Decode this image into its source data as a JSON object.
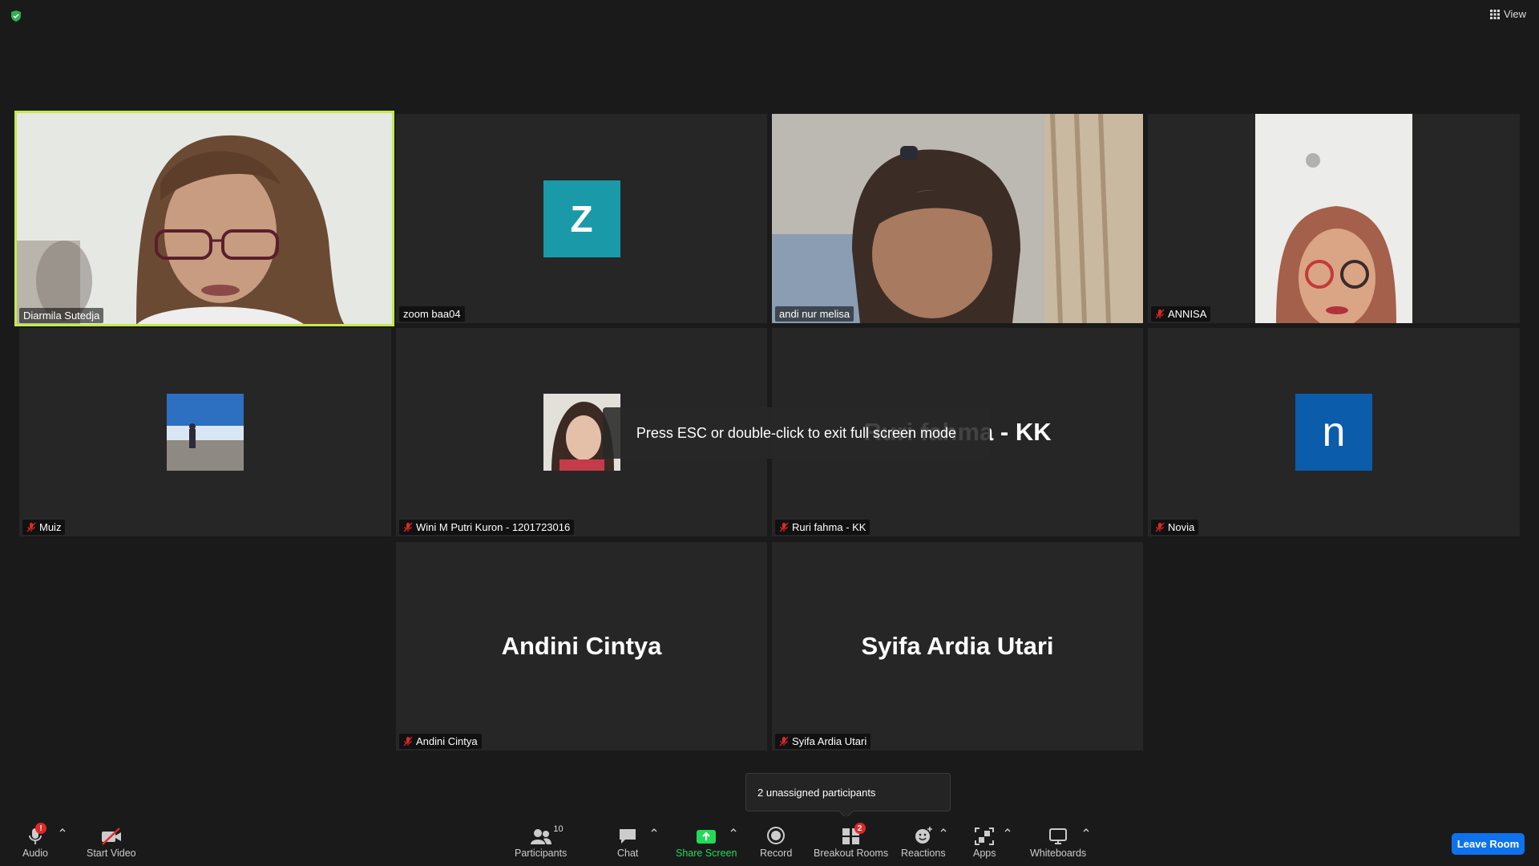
{
  "topbar": {
    "view_label": "View",
    "shield_icon": "shield-check-icon",
    "grid_icon": "grid-view-icon"
  },
  "tiles": [
    {
      "name": "Diarmila Sutedja",
      "type": "video",
      "muted": false,
      "active": true
    },
    {
      "name": "zoom baa04",
      "type": "letter",
      "letter": "Z",
      "color": "#1a9aa8",
      "muted": false
    },
    {
      "name": "andi nur melisa",
      "type": "video",
      "muted": false
    },
    {
      "name": "ANNISA",
      "type": "video",
      "muted": true
    },
    {
      "name": "Muiz",
      "type": "photo",
      "muted": true
    },
    {
      "name": "Wini M Putri Kuron - 1201723016",
      "type": "photo",
      "muted": true
    },
    {
      "name": "Ruri fahma - KK",
      "type": "bigname",
      "muted": true
    },
    {
      "name": "Novia",
      "type": "letter",
      "letter": "n",
      "color": "#0b5cab",
      "muted": true
    },
    {
      "name": "Andini Cintya",
      "type": "bigname",
      "muted": true
    },
    {
      "name": "Syifa Ardia Utari",
      "type": "bigname",
      "muted": true
    }
  ],
  "fullscreen_toast": "Press ESC or double-click to exit full screen mode",
  "breakout_popover": "2 unassigned participants",
  "toolbar": {
    "audio": {
      "label": "Audio",
      "badge": "!"
    },
    "video": {
      "label": "Start Video"
    },
    "participants": {
      "label": "Participants",
      "count": "10"
    },
    "chat": {
      "label": "Chat"
    },
    "share": {
      "label": "Share Screen"
    },
    "record": {
      "label": "Record"
    },
    "breakout": {
      "label": "Breakout Rooms",
      "badge": "2"
    },
    "reactions": {
      "label": "Reactions"
    },
    "apps": {
      "label": "Apps"
    },
    "whiteboards": {
      "label": "Whiteboards"
    },
    "leave": {
      "label": "Leave Room"
    }
  },
  "colors": {
    "active_border": "#c6e94d",
    "share_green": "#23d959",
    "leave_blue": "#0e72ed",
    "mute_red": "#e02828"
  }
}
